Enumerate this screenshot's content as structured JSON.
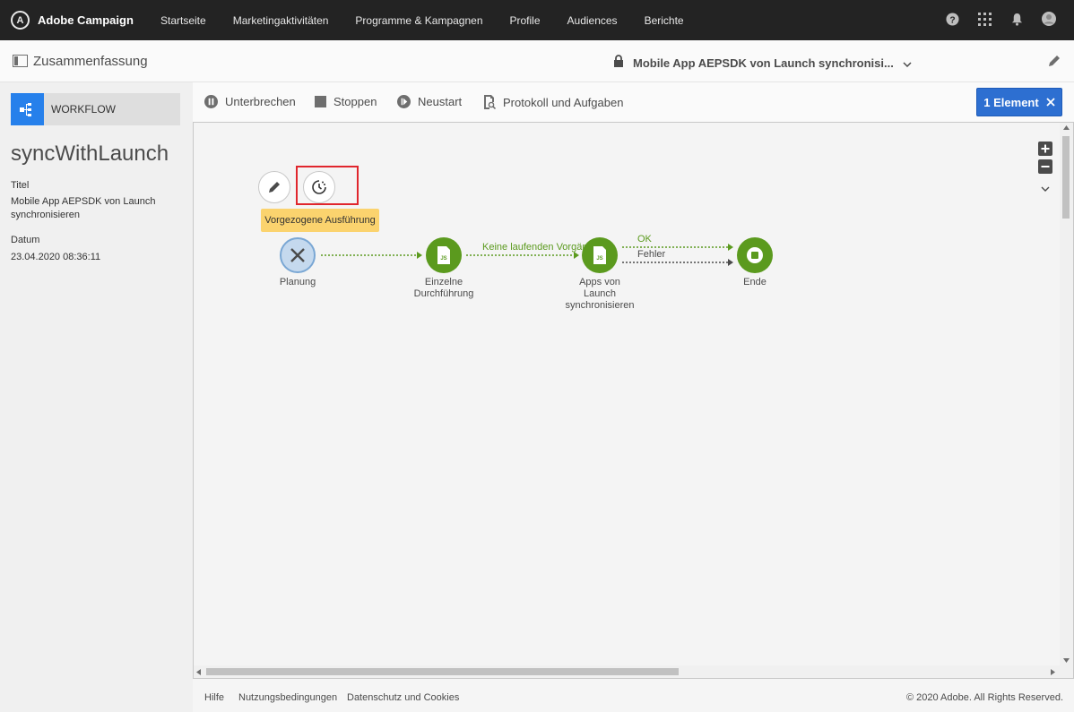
{
  "app": {
    "brand": "Adobe Campaign"
  },
  "nav": [
    "Startseite",
    "Marketingaktivitäten",
    "Programme & Kampagnen",
    "Profile",
    "Audiences",
    "Berichte"
  ],
  "header": {
    "summary_label": "Zusammenfassung",
    "workflow_title": "Mobile App AEPSDK von Launch synchronisi..."
  },
  "sidebar": {
    "tag": "WORKFLOW",
    "name": "syncWithLaunch",
    "title_label": "Titel",
    "title_value": "Mobile App AEPSDK von Launch synchronisieren",
    "date_label": "Datum",
    "date_value": "23.04.2020 08:36:11"
  },
  "toolbar": {
    "pause": "Unterbrechen",
    "stop": "Stoppen",
    "restart": "Neustart",
    "log": "Protokoll und Aufgaben",
    "selection": "1 Element"
  },
  "canvas": {
    "tooltip": "Vorgezogene Ausführung",
    "nodes": {
      "planung": "Planung",
      "einzelne_1": "Einzelne",
      "einzelne_2": "Durchführung",
      "apps_1": "Apps von",
      "apps_2": "Launch",
      "apps_3": "synchronisieren",
      "ende": "Ende"
    },
    "edges": {
      "keine": "Keine laufenden Vorgänge",
      "ok": "OK",
      "fehler": "Fehler"
    },
    "js_label": "JS"
  },
  "footer": {
    "help": "Hilfe",
    "terms": "Nutzungsbedingungen",
    "privacy": "Datenschutz und Cookies",
    "copyright": "© 2020 Adobe. All Rights Reserved."
  },
  "colors": {
    "accent": "#2d6fd1",
    "node_green": "#5b9a1e",
    "tooltip": "#fbd36e",
    "highlight_red": "#e0262d"
  }
}
